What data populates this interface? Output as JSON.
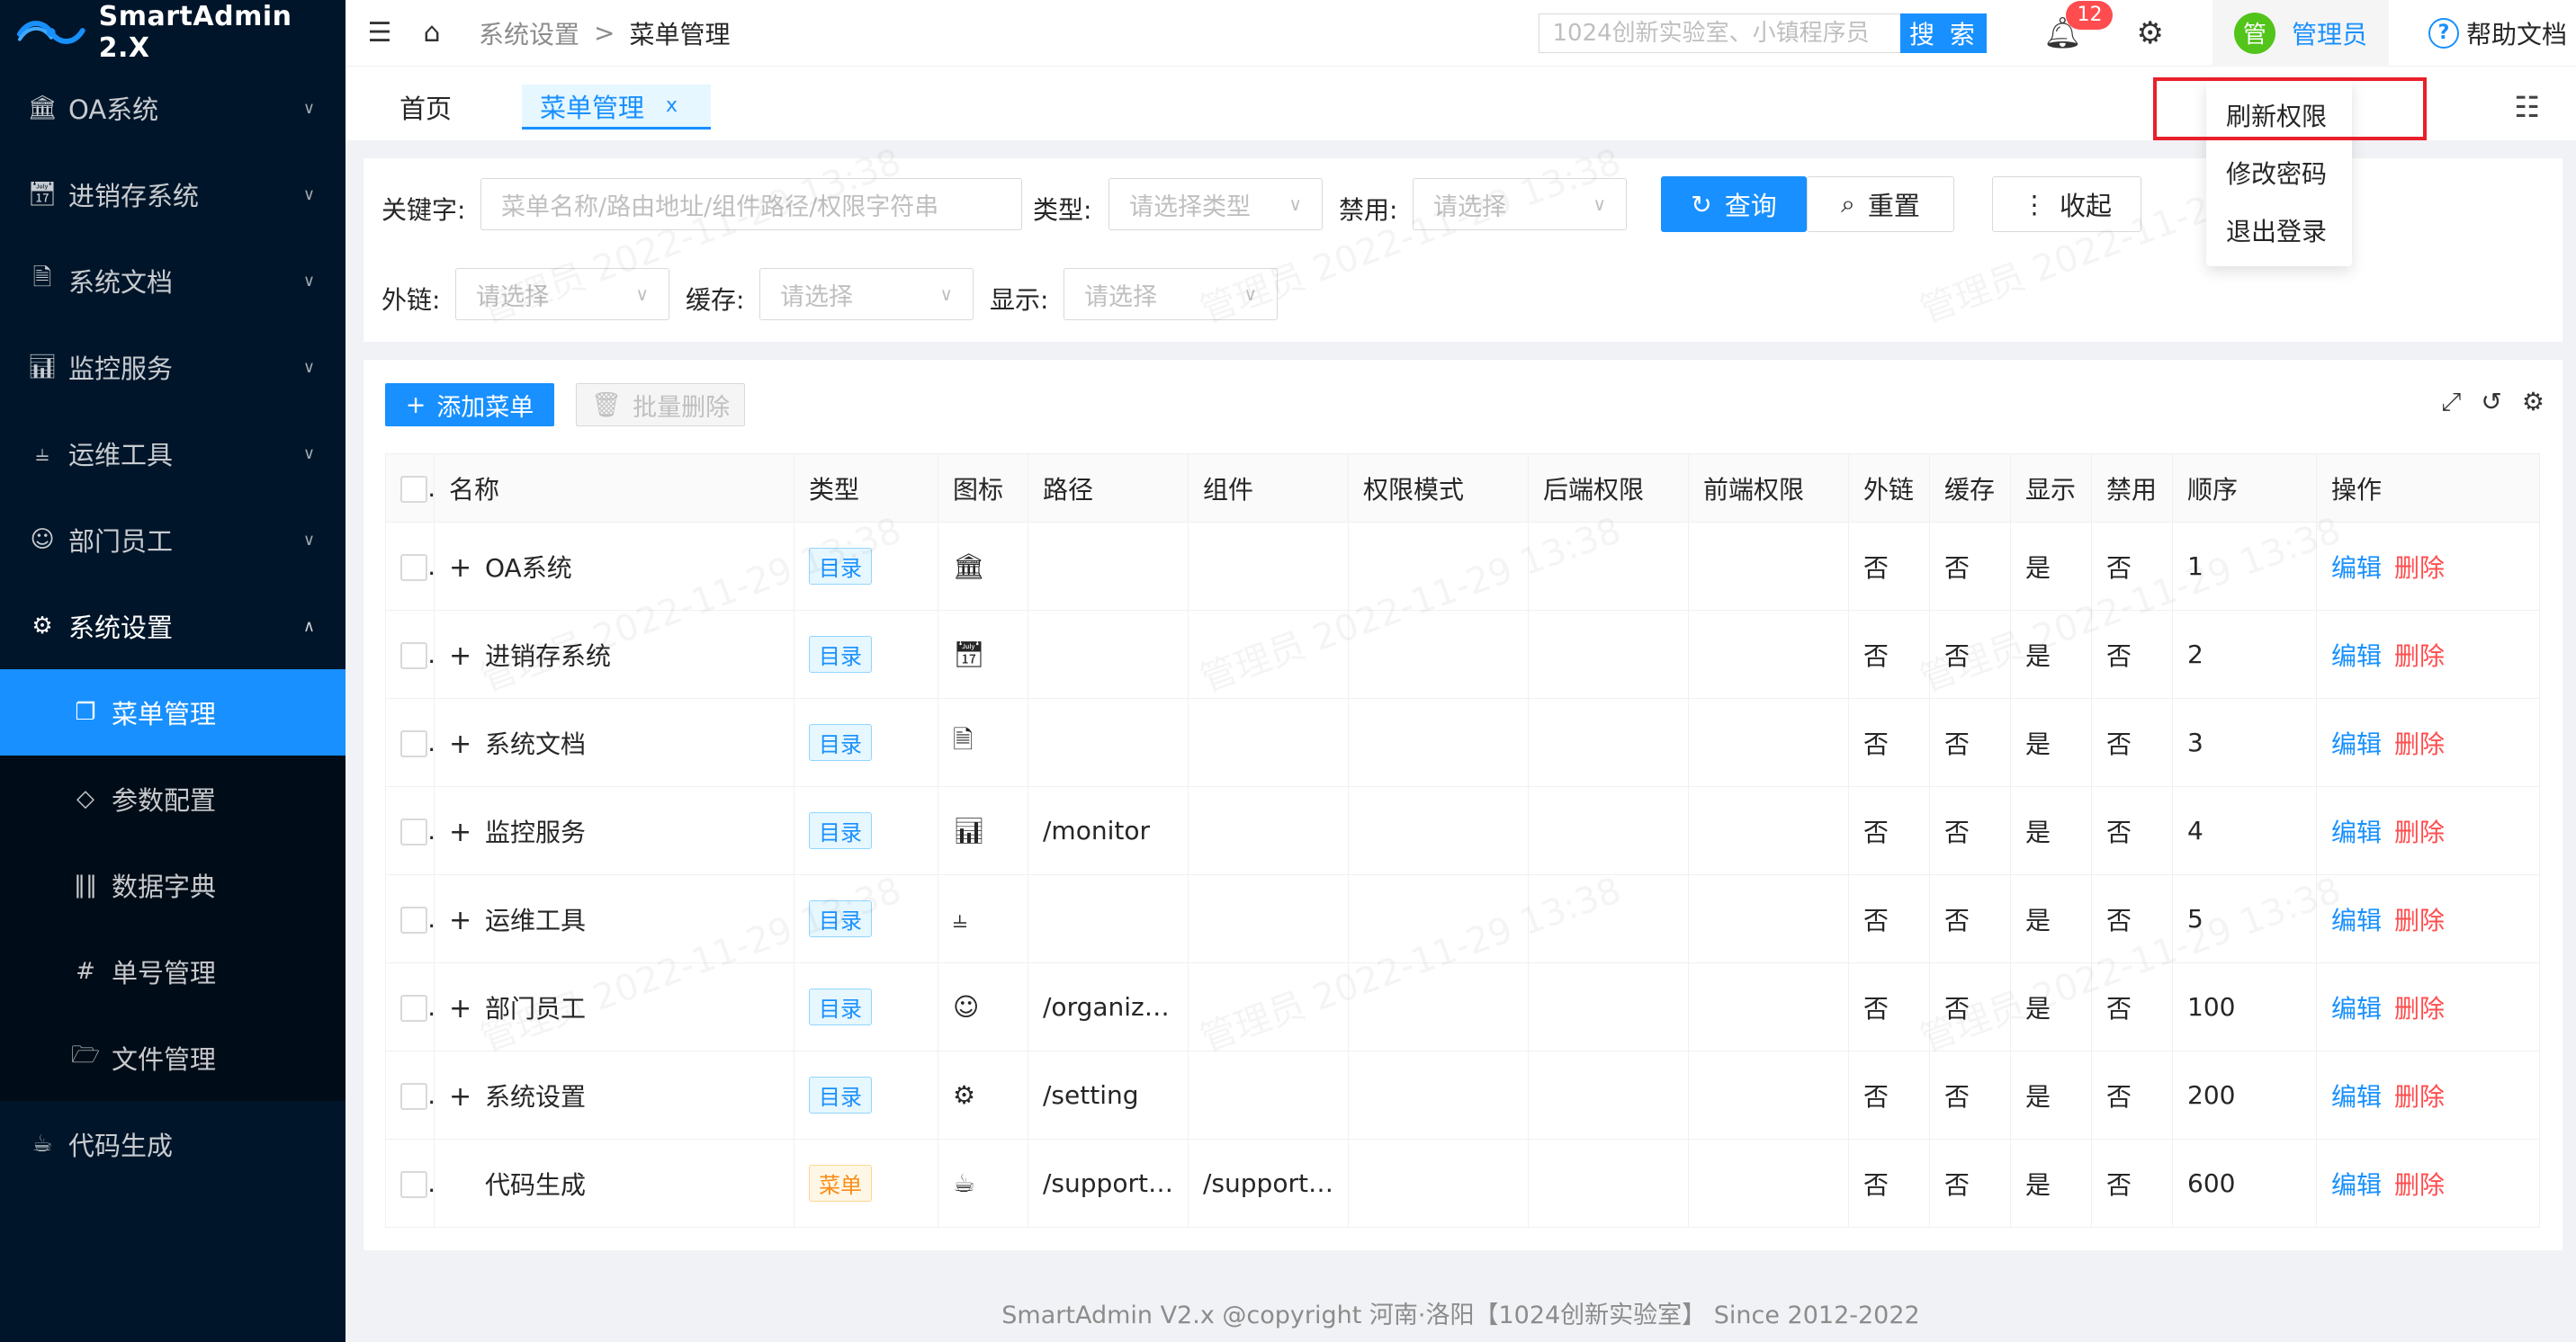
{
  "app": {
    "title": "SmartAdmin 2.X"
  },
  "sidebar": {
    "items": [
      {
        "label": "OA系统",
        "icon": "bank-icon"
      },
      {
        "label": "进销存系统",
        "icon": "calendar-yen-icon"
      },
      {
        "label": "系统文档",
        "icon": "document-icon"
      },
      {
        "label": "监控服务",
        "icon": "bar-chart-icon"
      },
      {
        "label": "运维工具",
        "icon": "tree-icon"
      },
      {
        "label": "部门员工",
        "icon": "user-icon"
      },
      {
        "label": "系统设置",
        "icon": "gear-icon"
      },
      {
        "label": "代码生成",
        "icon": "coffee-icon"
      }
    ],
    "sub_items": [
      {
        "label": "菜单管理",
        "icon": "copy-icon"
      },
      {
        "label": "参数配置",
        "icon": "diamond-icon"
      },
      {
        "label": "数据字典",
        "icon": "barcode-icon"
      },
      {
        "label": "单号管理",
        "icon": "hash-icon"
      },
      {
        "label": "文件管理",
        "icon": "folder-icon"
      }
    ]
  },
  "header": {
    "breadcrumb": [
      "系统设置",
      ">",
      "菜单管理"
    ],
    "search_placeholder": "1024创新实验室、小镇程序员",
    "search_label": "搜 索",
    "notification_count": "12",
    "avatar_char": "管",
    "user_name": "管理员",
    "help_label": "帮助文档"
  },
  "tabs": {
    "home": "首页",
    "menu": "菜单管理",
    "close": "x"
  },
  "dropdown": [
    "刷新权限",
    "修改密码",
    "退出登录"
  ],
  "filter": {
    "keyword_label": "关键字:",
    "keyword_placeholder": "菜单名称/路由地址/组件路径/权限字符串",
    "type_label": "类型:",
    "type_placeholder": "请选择类型",
    "disabled_label": "禁用:",
    "disabled_placeholder": "请选择",
    "query_label": "查询",
    "reset_label": "重置",
    "collapse_label": "收起",
    "external_label": "外链:",
    "external_placeholder": "请选择",
    "cache_label": "缓存:",
    "cache_placeholder": "请选择",
    "show_label": "显示:",
    "show_placeholder": "请选择"
  },
  "table": {
    "add_label": "添加菜单",
    "batch_delete_label": "批量删除",
    "columns": [
      "名称",
      "类型",
      "图标",
      "路径",
      "组件",
      "权限模式",
      "后端权限",
      "前端权限",
      "外链",
      "缓存",
      "显示",
      "禁用",
      "顺序",
      "操作"
    ],
    "edit_label": "编辑",
    "delete_label": "删除",
    "rows": [
      {
        "name": "OA系统",
        "type": "目录",
        "icon": "bank-icon",
        "path": "",
        "component": "",
        "ext": "否",
        "cache": "否",
        "show": "是",
        "disabled": "否",
        "order": "1"
      },
      {
        "name": "进销存系统",
        "type": "目录",
        "icon": "calendar-yen-icon",
        "path": "",
        "component": "",
        "ext": "否",
        "cache": "否",
        "show": "是",
        "disabled": "否",
        "order": "2"
      },
      {
        "name": "系统文档",
        "type": "目录",
        "icon": "document-icon",
        "path": "",
        "component": "",
        "ext": "否",
        "cache": "否",
        "show": "是",
        "disabled": "否",
        "order": "3"
      },
      {
        "name": "监控服务",
        "type": "目录",
        "icon": "bar-chart-icon",
        "path": "/monitor",
        "component": "",
        "ext": "否",
        "cache": "否",
        "show": "是",
        "disabled": "否",
        "order": "4"
      },
      {
        "name": "运维工具",
        "type": "目录",
        "icon": "tree-icon",
        "path": "",
        "component": "",
        "ext": "否",
        "cache": "否",
        "show": "是",
        "disabled": "否",
        "order": "5"
      },
      {
        "name": "部门员工",
        "type": "目录",
        "icon": "user-icon",
        "path": "/organiza...",
        "component": "",
        "ext": "否",
        "cache": "否",
        "show": "是",
        "disabled": "否",
        "order": "100"
      },
      {
        "name": "系统设置",
        "type": "目录",
        "icon": "gear-icon",
        "path": "/setting",
        "component": "",
        "ext": "否",
        "cache": "否",
        "show": "是",
        "disabled": "否",
        "order": "200"
      },
      {
        "name": "代码生成",
        "type": "菜单",
        "icon": "coffee-icon",
        "path": "/support/...",
        "component": "/support/...",
        "ext": "否",
        "cache": "否",
        "show": "是",
        "disabled": "否",
        "order": "600"
      }
    ]
  },
  "watermark": "管理员 2022-11-29 13:38",
  "footer": "SmartAdmin V2.x @copyright 河南·洛阳【1024创新实验室】 Since 2012-2022"
}
